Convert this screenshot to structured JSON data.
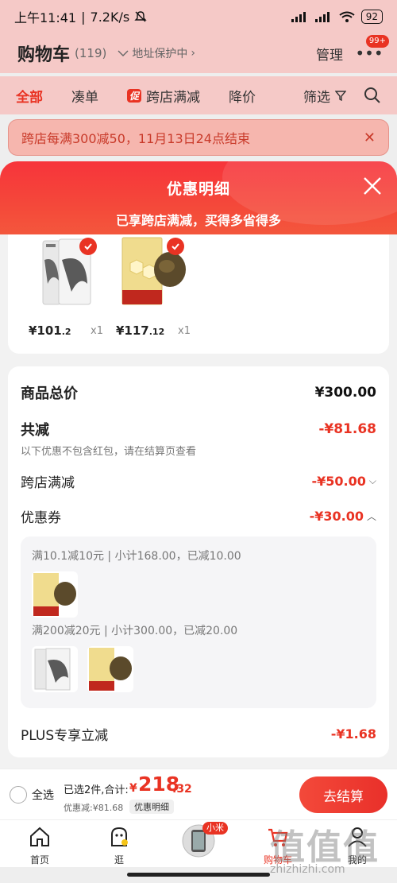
{
  "status_bar": {
    "time": "上午11:41",
    "speed": "7.2K/s",
    "battery": "92"
  },
  "header": {
    "title": "购物车",
    "count": "(119)",
    "address": "地址保护中",
    "manage": "管理",
    "more_badge": "99+"
  },
  "tabs": {
    "items": [
      "全部",
      "凑单",
      "跨店满减",
      "降价"
    ],
    "promo_badge": "促",
    "filter": "筛选"
  },
  "promo_banner": {
    "text": "跨店每满300减50，11月13日24点结束"
  },
  "sheet": {
    "title": "优惠明细",
    "subtitle": "已享跨店满减，买得多省得多",
    "items": [
      {
        "price_int": "¥101",
        "price_dec": ".2",
        "qty": "x1"
      },
      {
        "price_int": "¥117",
        "price_dec": ".12",
        "qty": "x1"
      }
    ],
    "summary": {
      "total_label": "商品总价",
      "total_value": "¥300.00",
      "discount_label": "共减",
      "discount_value": "-¥81.68",
      "discount_note": "以下优惠不包含红包，请在结算页查看",
      "cross_store_label": "跨店满减",
      "cross_store_value": "-¥50.00",
      "coupon_label": "优惠券",
      "coupon_value": "-¥30.00",
      "coupon_lines": [
        "满10.1减10元 | 小计168.00，已减10.00",
        "满200减20元 | 小计300.00，已减20.00"
      ],
      "plus_label": "PLUS专享立减",
      "plus_value": "-¥1.68"
    }
  },
  "checkout": {
    "select_all": "全选",
    "selected": "已选2件,合计:",
    "currency": "¥",
    "total_int": "218",
    "total_dec": ".32",
    "discount_small": "优惠减:¥81.68",
    "detail_pill": "优惠明细",
    "button": "去结算"
  },
  "nav": {
    "items": [
      "首页",
      "逛",
      "购物车",
      "我的"
    ],
    "mi_badge": "小米"
  },
  "watermark": {
    "text": "值值值",
    "url": "zhizhizhi.com"
  },
  "colors": {
    "accent": "#e93323",
    "sheet_header": "#f7343b"
  }
}
